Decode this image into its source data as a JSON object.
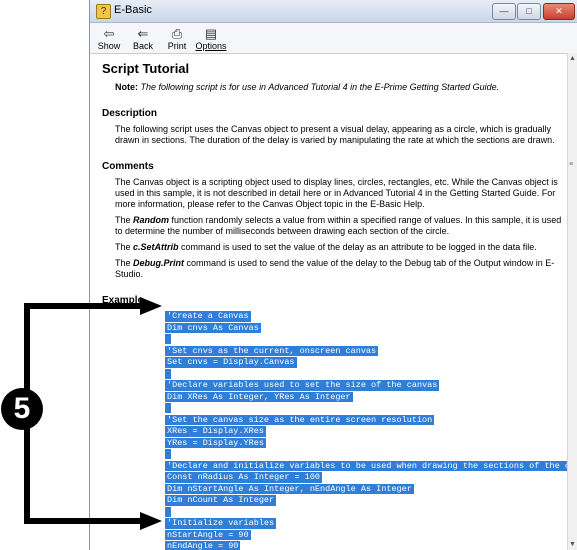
{
  "window": {
    "title": "E-Basic"
  },
  "toolbar": [
    {
      "label": "Show",
      "icon": "show-icon"
    },
    {
      "label": "Back",
      "icon": "back-arrow-icon"
    },
    {
      "label": "Print",
      "icon": "printer-icon"
    },
    {
      "label": "Options",
      "icon": "options-icon"
    }
  ],
  "content": {
    "title": "Script Tutorial",
    "note": {
      "label": "Note:",
      "text": "The following script is for use in Advanced Tutorial 4 in the E-Prime Getting Started Guide."
    },
    "description": {
      "heading": "Description",
      "text": "The following script uses the Canvas object to present a visual delay, appearing as a circle, which is gradually drawn in sections.  The duration of the delay is varied by manipulating the rate at which the sections are drawn."
    },
    "comments": {
      "heading": "Comments",
      "p1": "The Canvas object is a scripting object used to display lines, circles, rectangles, etc.  While the Canvas object is used in this sample, it is not described in detail here or in Advanced Tutorial 4 in the Getting Started Guide.  For more information, please refer to the Canvas Object topic in the E-Basic Help.",
      "p2_kw": "Random",
      "p2_rest": " function randomly selects a value from within a specified range of values.  In this sample, it is used to determine the number of milliseconds between drawing each section of the circle.",
      "p3_kw": "c.SetAttrib",
      "p3_rest": " command is used to set the value of the delay as an attribute to be logged in the data file.",
      "p4_kw": "Debug.Print",
      "p4_rest": " command is used to send the value of the delay to the Debug tab of the Output window in E-Studio.",
      "the": "The "
    },
    "example": {
      "heading": "Example",
      "lines": [
        "'Create a Canvas",
        "Dim cnvs As Canvas",
        "",
        "'Set cnvs as the current, onscreen canvas",
        "Set cnvs = Display.Canvas",
        "",
        "'Declare variables used to set the size of the canvas",
        "Dim XRes As Integer, YRes As Integer",
        "",
        "'Set the canvas size as the entire screen resolution",
        "XRes = Display.XRes",
        "YRes = Display.YRes",
        "",
        "'Declare and initialize variables to be used when drawing the sections of the circle",
        "Const nRadius As Integer = 100",
        "Dim nStartAngle As Integer, nEndAngle As Integer",
        "Dim nCount As Integer",
        "",
        "'Initialize variables",
        "nStartAngle = 90",
        "nEndAngle = 90"
      ]
    }
  },
  "callout": {
    "number": "5"
  }
}
